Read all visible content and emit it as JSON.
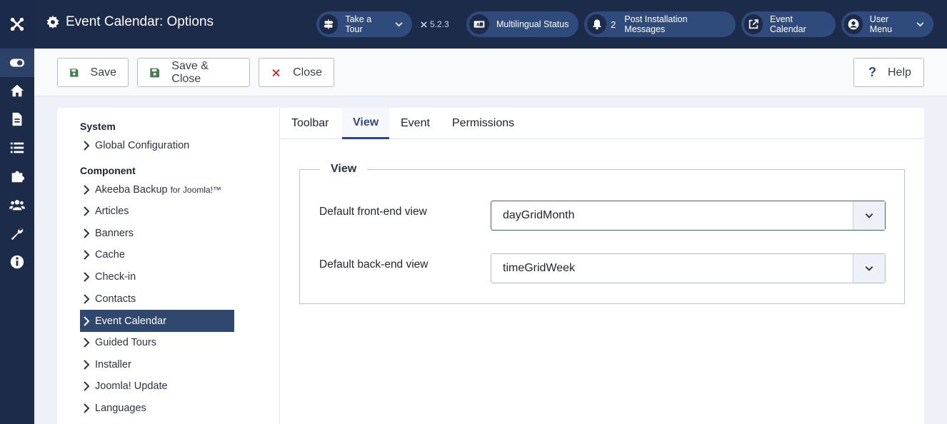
{
  "header": {
    "title": "Event Calendar: Options",
    "take_tour": "Take a Tour",
    "version": "5.2.3",
    "multilingual": "Multilingual Status",
    "post_install_count": "2",
    "post_install": "Post Installation Messages",
    "event_calendar": "Event Calendar",
    "user_menu": "User Menu"
  },
  "toolbar": {
    "save": "Save",
    "save_close": "Save & Close",
    "close": "Close",
    "help": "Help"
  },
  "nav": {
    "system_heading": "System",
    "global_config": "Global Configuration",
    "component_heading": "Component",
    "items": [
      {
        "label": "Akeeba Backup",
        "suffix": "for Joomla!™"
      },
      {
        "label": "Articles"
      },
      {
        "label": "Banners"
      },
      {
        "label": "Cache"
      },
      {
        "label": "Check-in"
      },
      {
        "label": "Contacts"
      },
      {
        "label": "Event Calendar"
      },
      {
        "label": "Guided Tours"
      },
      {
        "label": "Installer"
      },
      {
        "label": "Joomla! Update"
      },
      {
        "label": "Languages"
      }
    ]
  },
  "tabs": [
    "Toolbar",
    "View",
    "Event",
    "Permissions"
  ],
  "view": {
    "legend": "View",
    "frontend_label": "Default front-end view",
    "frontend_value": "dayGridMonth",
    "backend_label": "Default back-end view",
    "backend_value": "timeGridWeek"
  },
  "colors": {
    "sidebar": "#1d2b4a",
    "pill": "#2f4b7c",
    "active_nav": "#30486e",
    "save_icon": "#457d54",
    "close_icon": "#c52827",
    "help_icon": "#2f4a7a"
  }
}
